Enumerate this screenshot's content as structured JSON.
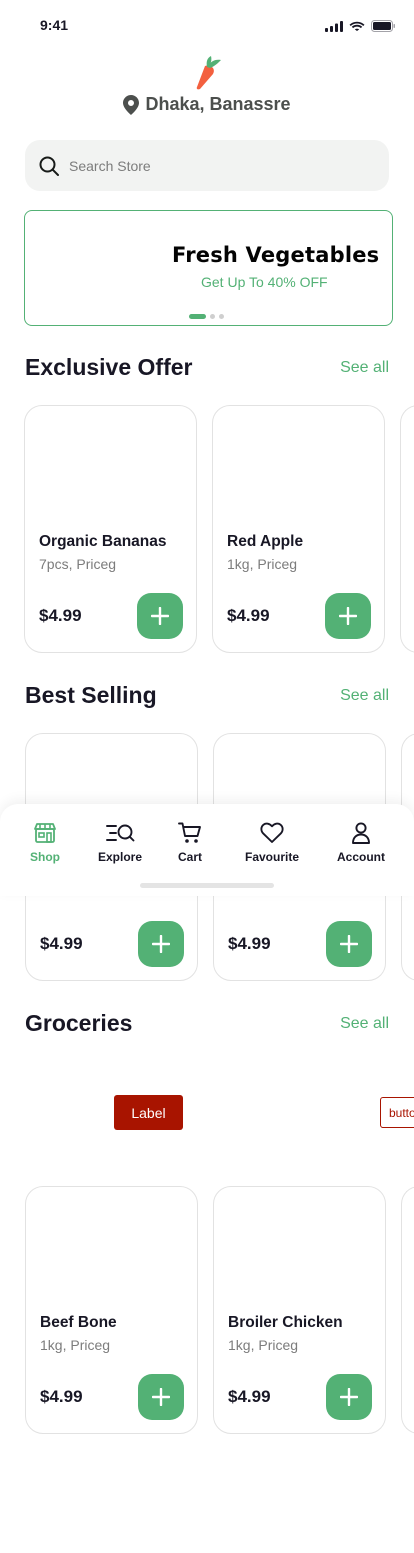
{
  "status_bar": {
    "time": "9:41"
  },
  "location": {
    "label": "Dhaka, Banassre",
    "icon": "location-pin-icon"
  },
  "search": {
    "placeholder": "Search Store",
    "icon": "search-icon"
  },
  "banner": {
    "title": "Fresh Vegetables",
    "subtitle": "Get Up To 40% OFF",
    "slides": 3,
    "active_slide": 1
  },
  "sections": {
    "exclusive": {
      "title": "Exclusive Offer",
      "see_all": "See all",
      "products": [
        {
          "name": "Organic Bananas",
          "meta": "7pcs, Priceg",
          "price": "$4.99"
        },
        {
          "name": "Red Apple",
          "meta": "1kg, Priceg",
          "price": "$4.99"
        }
      ]
    },
    "best": {
      "title": "Best Selling",
      "see_all": "See all",
      "products": [
        {
          "name": "",
          "meta": "",
          "price": "$4.99"
        },
        {
          "name": "",
          "meta": "",
          "price": "$4.99"
        }
      ]
    },
    "groceries": {
      "title": "Groceries",
      "see_all": "See all",
      "chips": {
        "label": "Label",
        "button": "butto"
      },
      "products": [
        {
          "name": "Beef Bone",
          "meta": "1kg, Priceg",
          "price": "$4.99"
        },
        {
          "name": "Broiler Chicken",
          "meta": "1kg, Priceg",
          "price": "$4.99"
        }
      ]
    }
  },
  "tabbar": {
    "items": [
      {
        "label": "Shop",
        "icon": "shop-icon",
        "active": true
      },
      {
        "label": "Explore",
        "icon": "explore-icon",
        "active": false
      },
      {
        "label": "Cart",
        "icon": "cart-icon",
        "active": false
      },
      {
        "label": "Favourite",
        "icon": "heart-icon",
        "active": false
      },
      {
        "label": "Account",
        "icon": "account-icon",
        "active": false
      }
    ]
  },
  "colors": {
    "accent": "#53B175",
    "text": "#181725",
    "muted": "#7C7C7C",
    "label_red": "#A81400",
    "carrot": "#F3603F"
  }
}
